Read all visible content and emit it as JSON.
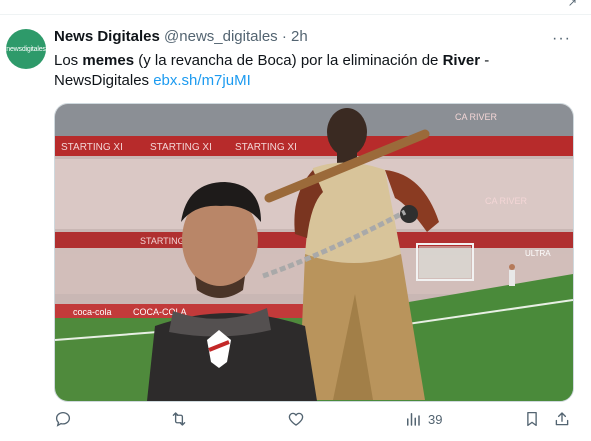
{
  "author": {
    "name": "News Digitales",
    "handle": "@news_digitales",
    "separator": "·",
    "time": "2h",
    "avatar_text": "newsdigitales"
  },
  "tweet": {
    "text_1": "Los ",
    "bold_1": "memes",
    "text_2": " (y la revancha de Boca) por la eliminación de ",
    "bold_2": "River",
    "text_3": " -",
    "text_4": "NewsDigitales ",
    "link": "ebx.sh/m7juMI"
  },
  "media": {
    "stadium_banners": [
      "STARTING XI",
      "STARTING XI",
      "STARTING XI",
      "STARTING XI",
      "CA RIVER",
      "STARTING",
      "CA RIVER",
      "coca-cola",
      "COCA-COLA",
      "ULTRA"
    ],
    "colors": {
      "pitch": "#4f8a3c",
      "banner_red": "#b72b2b"
    }
  },
  "actions": {
    "reply_icon": "reply-icon",
    "retweet_icon": "retweet-icon",
    "like_icon": "heart-icon",
    "views_icon": "views-icon",
    "views_count": "39",
    "bookmark_icon": "bookmark-icon",
    "share_icon": "share-icon"
  },
  "menu": {
    "more_label": "···"
  }
}
